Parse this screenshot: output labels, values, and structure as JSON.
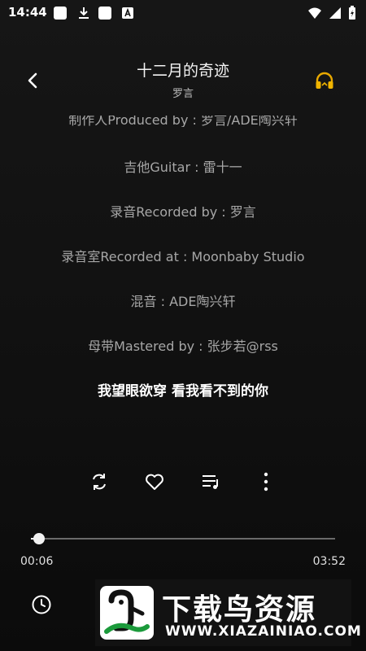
{
  "status_bar": {
    "time": "14:44"
  },
  "header": {
    "title": "十二月的奇迹",
    "artist": "罗言"
  },
  "lyrics": {
    "partial": "制作人Produced by : 罗言/ADE陶兴轩",
    "lines": [
      "吉他Guitar : 雷十一",
      "录音Recorded by : 罗言",
      "录音室Recorded at : Moonbaby Studio",
      "混音 : ADE陶兴轩",
      "母带Mastered by : 张步若@rss"
    ],
    "current": "我望眼欲穿 看我看不到的你"
  },
  "player": {
    "current_time": "00:06",
    "total_time": "03:52",
    "progress": 0.026
  },
  "watermark": {
    "title": "下载鸟资源",
    "url": "WWW.XIAZAINIAO.COM"
  },
  "colors": {
    "background": "#121212",
    "accent": "#f0b400",
    "text": "#ffffff",
    "muted": "#a7a7a7"
  }
}
